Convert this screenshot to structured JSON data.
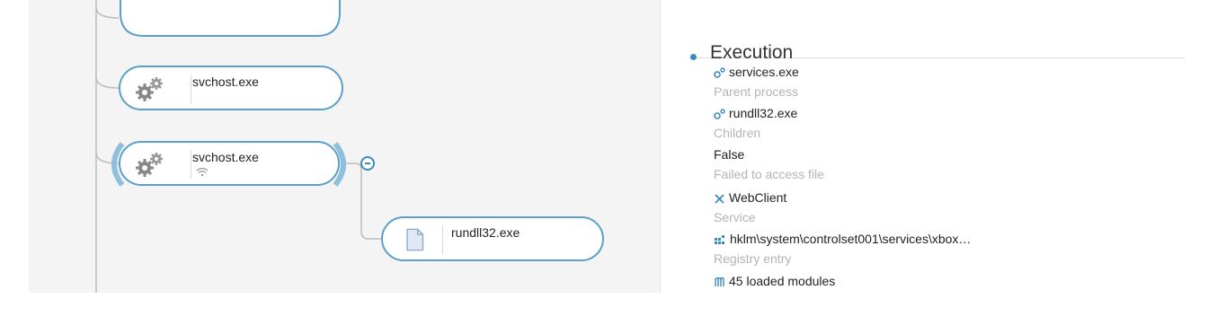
{
  "tree": {
    "nodes": [
      {
        "name": "svchost.exe",
        "icon": "gears-icon"
      },
      {
        "name": "svchost.exe",
        "icon": "gears-icon",
        "indicator": "wifi-icon"
      },
      {
        "name": "rundll32.exe",
        "icon": "document-icon"
      }
    ]
  },
  "details": {
    "section_title": "Execution",
    "rows": [
      {
        "value": "services.exe",
        "label": "Parent process",
        "icon": "process-icon"
      },
      {
        "value": "rundll32.exe",
        "label": "Children",
        "icon": "process-icon"
      },
      {
        "value": "False",
        "label": "Failed to access file"
      },
      {
        "value": "WebClient",
        "label": "Service",
        "icon": "tools-icon"
      },
      {
        "value": "hklm\\system\\controlset001\\services\\xbox…",
        "label": "Registry entry",
        "icon": "registry-icon"
      },
      {
        "value": "45 loaded modules",
        "icon": "modules-icon"
      }
    ]
  },
  "colors": {
    "accent": "#3a8cc0",
    "node_border": "#5aa0c9",
    "panel_bg": "#f4f4f4",
    "label_gray": "#b4b4b4"
  }
}
